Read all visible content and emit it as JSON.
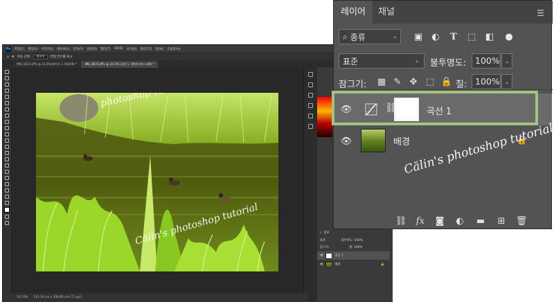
{
  "photoshop": {
    "app_icon": "Ps",
    "menu": [
      "파일(F)",
      "편집(E)",
      "이미지(I)",
      "레이어(L)",
      "문자(Y)",
      "선택(S)",
      "필터(T)",
      "3D(D)",
      "보기(V)",
      "플러그인",
      "창(W)",
      "도움말(H)"
    ],
    "options": {
      "auto_select_label": "자동 선택:",
      "auto_select_value": "레이어",
      "transform_label": "변형 컨트롤 표시"
    },
    "doc_tabs": [
      {
        "label": "IMG_8212.JPG @ 33.3%(레이어 1, RGB/8) *",
        "active": false
      },
      {
        "label": "IMG_8673.JPG @ 33.3% (곡선 1, 레이어 마스크/8) *",
        "active": true
      }
    ],
    "status": {
      "zoom": "33.33%",
      "doc_info": "142.24 cm x 106.68 cm (72 ppi)"
    },
    "mini_layers": {
      "search_label": "종류",
      "blend": "표준",
      "opacity": "불투명도: 100%",
      "lock": "잠그기:",
      "fill": "칠: 100%",
      "rows": [
        {
          "name": "곡선 1",
          "selected": true
        },
        {
          "name": "배경",
          "selected": false
        }
      ]
    },
    "watermark": "Călin's photoshop tutorial",
    "watermark_top": "photoshop tutorial"
  },
  "layers_panel": {
    "tabs": [
      {
        "label": "레이어",
        "active": true
      },
      {
        "label": "채널",
        "active": false
      }
    ],
    "menu_icon": "hamburger-icon",
    "filter": {
      "label": "종류"
    },
    "blend_mode": "표준",
    "opacity_label": "불투명도:",
    "opacity_value": "100%",
    "lock_label": "잠그기:",
    "fill_label": "칠:",
    "fill_value": "100%",
    "layers": [
      {
        "name": "곡선 1",
        "selected": true
      },
      {
        "name": "배경",
        "selected": false,
        "locked": true
      }
    ],
    "highlight_color": "#a2c481",
    "signature": "Călin's photoshop tutorial"
  }
}
